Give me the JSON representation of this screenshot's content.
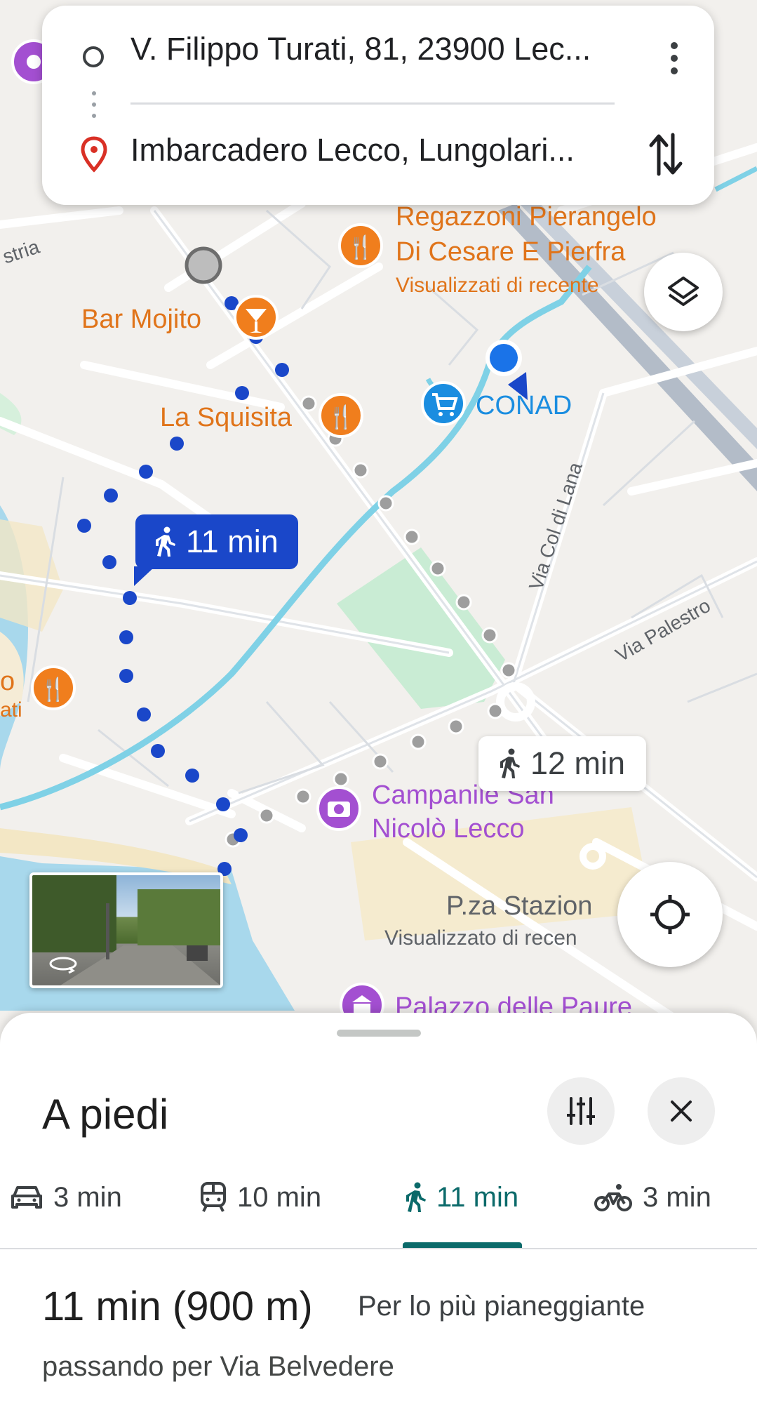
{
  "route": {
    "origin": "V. Filippo Turati, 81, 23900 Lec...",
    "destination": "Imbarcadero Lecco, Lungolari..."
  },
  "map": {
    "walk_badge": "11 min",
    "alt_badge": "12 min",
    "pois": {
      "regazzoni_line1": "Regazzoni Pierangelo",
      "regazzoni_line2": "Di Cesare E Pierfra",
      "regazzoni_sub": "Visualizzati di recente",
      "bar_mojito": "Bar Mojito",
      "la_squisita": "La Squisita",
      "conad": "CONAD",
      "campanile_line1": "Campanile San",
      "campanile_line2": "Nicolò Lecco",
      "piazza_stazione": "P.za Stazion",
      "piazza_sub": "Visualizzato di recen",
      "palazzo": "Palazzo delle Paure",
      "left_partial_1": "o",
      "left_partial_2": "ati"
    },
    "streets": {
      "istria": "stria",
      "col_di_lana": "Via Col di Lana",
      "palestro": "Via Palestro"
    }
  },
  "sheet": {
    "title": "A piedi",
    "modes": [
      {
        "label": "3 min",
        "icon": "car-icon"
      },
      {
        "label": "10 min",
        "icon": "train-icon"
      },
      {
        "label": "11 min",
        "icon": "walk-icon"
      },
      {
        "label": "3 min",
        "icon": "bike-icon"
      }
    ],
    "summary_main": "11 min (900 m)",
    "summary_sub": "Per lo più pianeggiante",
    "summary_via": "passando per Via Belvedere"
  },
  "colors": {
    "route_blue": "#1a47c9",
    "route_gray": "#9e9e9e",
    "poi_orange": "#f07e1d",
    "poi_purple": "#a34fd1",
    "conad_blue": "#1a8de0",
    "active_teal": "#0b6a6a",
    "water": "#a8d8ec",
    "river": "#7fd1e6",
    "park": "#c9ecd4"
  }
}
